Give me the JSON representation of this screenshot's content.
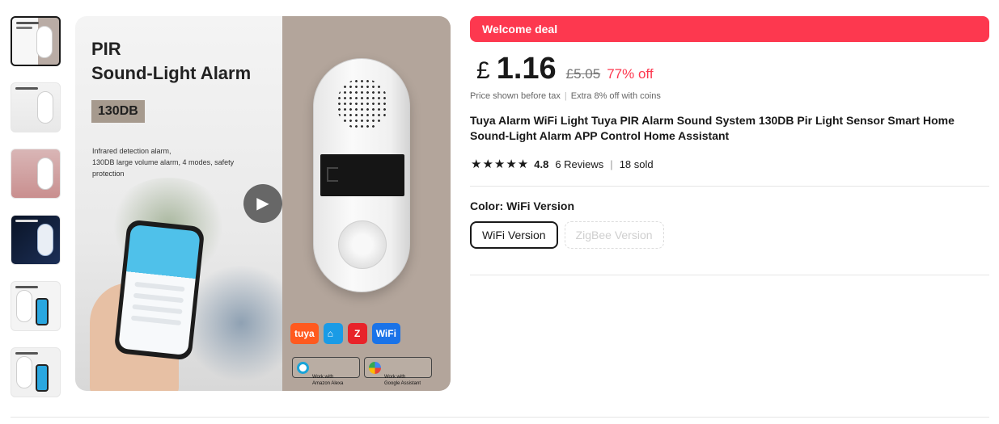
{
  "gallery": {
    "thumbnails": [
      {
        "name": "thumb-1",
        "label": "PIR Sound-Light Alarm",
        "active": true
      },
      {
        "name": "thumb-2",
        "label": "High-Pitched Alarm",
        "active": false
      },
      {
        "name": "thumb-3",
        "label": "",
        "active": false
      },
      {
        "name": "thumb-4",
        "label": "Low Power Consumption",
        "active": false
      },
      {
        "name": "thumb-5",
        "label": "Mobile APP control",
        "active": false
      },
      {
        "name": "thumb-6",
        "label": "Alarm Information Push Switch",
        "active": false
      }
    ],
    "main": {
      "title_line1": "PIR",
      "title_line2": "Sound-Light Alarm",
      "badge": "130DB",
      "description": "Infrared detection alarm,\n130DB large volume alarm, 4 modes, safety\nprotection",
      "play_icon": "play-icon",
      "logos": [
        "tuya",
        "⌂",
        "Z",
        "WiFi"
      ],
      "works_alexa": "Work with\nAmazon Alexa",
      "works_google": "Work with\nGoogle Assistant"
    }
  },
  "product": {
    "deal_banner": "Welcome deal",
    "currency": "£",
    "price": "1.16",
    "original_price": "£5.05",
    "discount": "77% off",
    "price_note": "Price shown before tax",
    "price_note_extra": "Extra 8% off with coins",
    "title": "Tuya Alarm WiFi Light Tuya PIR Alarm Sound System 130DB Pir Light Sensor Smart Home Sound-Light Alarm APP Control Home Assistant",
    "stars": "★★★★★",
    "rating": "4.8",
    "reviews": "6 Reviews",
    "sold": "18 sold",
    "color_label": "Color: WiFi Version",
    "options": [
      {
        "label": "WiFi Version",
        "state": "selected"
      },
      {
        "label": "ZigBee Version",
        "state": "disabled"
      }
    ]
  },
  "colors": {
    "deal_red": "#fd384f",
    "text_dark": "#191919",
    "divider": "#e6e6e6"
  }
}
